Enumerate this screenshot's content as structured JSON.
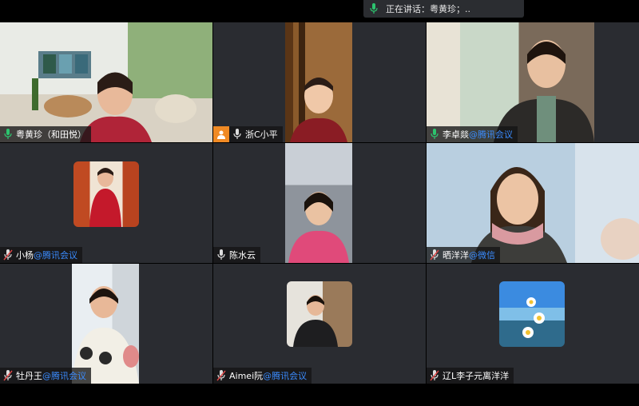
{
  "speaking_banner": "正在讲话：粤黄珍；..",
  "tiles": [
    {
      "name": "粤黄珍（和田悦）",
      "suffix": "",
      "camera_off": false,
      "active": true
    },
    {
      "name": "浙C小平",
      "suffix": "",
      "camera_off": true,
      "active": false
    },
    {
      "name": "李卓燚",
      "suffix": "@腾讯会议",
      "camera_off": false,
      "active": false
    },
    {
      "name": "小杨",
      "suffix": "@腾讯会议",
      "camera_off": false,
      "active": false
    },
    {
      "name": "陈水云",
      "suffix": "",
      "camera_off": false,
      "active": false
    },
    {
      "name": "晒洋洋",
      "suffix": "@微信",
      "camera_off": false,
      "active": false
    },
    {
      "name": "牡丹王",
      "suffix": "@腾讯会议",
      "camera_off": false,
      "active": false
    },
    {
      "name": "Aimei阮",
      "suffix": "@腾讯会议",
      "camera_off": false,
      "active": false
    },
    {
      "name": "辽L李子元离洋洋",
      "suffix": "",
      "camera_off": false,
      "active": false
    }
  ],
  "colors": {
    "active_border": "#2cc46e",
    "tile_bg": "#2a2c31",
    "tag_link": "#3b8cff",
    "mic_green": "#2cc46e",
    "cam_off": "#f08a24"
  }
}
